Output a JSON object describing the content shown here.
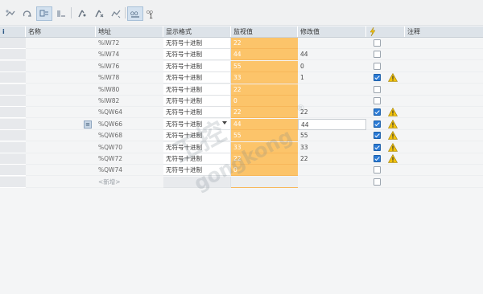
{
  "toolbar": {
    "buttons": [
      {
        "name": "monitor-all-icon"
      },
      {
        "name": "refresh-icon"
      },
      {
        "name": "show-expanded-icon",
        "active": true
      },
      {
        "name": "display-options-icon"
      },
      {
        "name": "modify-once-icon"
      },
      {
        "name": "modify-trigger-icon"
      },
      {
        "name": "monitor-once-icon"
      },
      {
        "name": "force-icon",
        "active": true
      },
      {
        "name": "force-one-icon",
        "label": "1"
      }
    ]
  },
  "table": {
    "headers": {
      "index": "i",
      "name": "名称",
      "address": "地址",
      "display_format": "显示格式",
      "monitor_value": "监视值",
      "modify_value": "修改值",
      "flag_icon": "lightning-icon",
      "comment": "注释"
    },
    "rows": [
      {
        "name": "",
        "address": "%IW72",
        "format": "无符号十进制",
        "monitor": "22",
        "modify": "",
        "checked": false,
        "warn": false
      },
      {
        "name": "",
        "address": "%IW74",
        "format": "无符号十进制",
        "monitor": "44",
        "modify": "44",
        "checked": false,
        "warn": false
      },
      {
        "name": "",
        "address": "%IW76",
        "format": "无符号十进制",
        "monitor": "55",
        "modify": "0",
        "checked": false,
        "warn": false
      },
      {
        "name": "",
        "address": "%IW78",
        "format": "无符号十进制",
        "monitor": "33",
        "modify": "1",
        "checked": true,
        "warn": true
      },
      {
        "name": "",
        "address": "%IW80",
        "format": "无符号十进制",
        "monitor": "22",
        "modify": "",
        "checked": false,
        "warn": false
      },
      {
        "name": "",
        "address": "%IW82",
        "format": "无符号十进制",
        "monitor": "0",
        "modify": "",
        "checked": false,
        "warn": false
      },
      {
        "name": "",
        "address": "%QW64",
        "format": "无符号十进制",
        "monitor": "22",
        "modify": "22",
        "checked": true,
        "warn": true
      },
      {
        "name": "",
        "address": "%QW66",
        "format": "无符号十进制",
        "monitor": "44",
        "modify": "44",
        "checked": true,
        "warn": true,
        "selected": true
      },
      {
        "name": "",
        "address": "%QW68",
        "format": "无符号十进制",
        "monitor": "55",
        "modify": "55",
        "checked": true,
        "warn": true
      },
      {
        "name": "",
        "address": "%QW70",
        "format": "无符号十进制",
        "monitor": "33",
        "modify": "33",
        "checked": true,
        "warn": true
      },
      {
        "name": "",
        "address": "%QW72",
        "format": "无符号十进制",
        "monitor": "22",
        "modify": "22",
        "checked": true,
        "warn": true
      },
      {
        "name": "",
        "address": "%QW74",
        "format": "无符号十进制",
        "monitor": "0",
        "modify": "",
        "checked": false,
        "warn": false
      }
    ],
    "add_row_label": "<新增>"
  },
  "watermark": {
    "line1": "工控",
    "line2": "gongkong",
    "mark": "®"
  },
  "colors": {
    "monitor_bg": "#fcc46a",
    "checkbox_on": "#2b7bd6",
    "warning": "#f2c20c"
  }
}
